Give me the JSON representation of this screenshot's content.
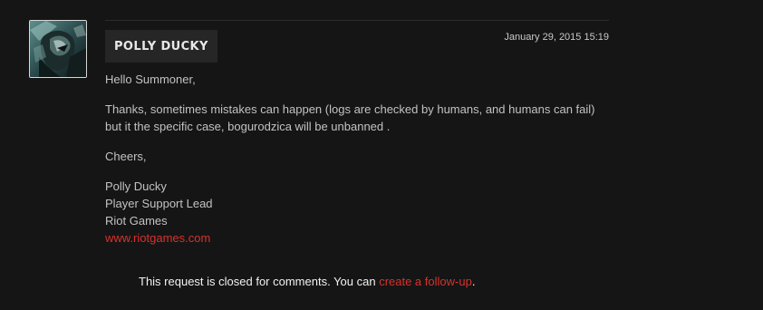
{
  "post": {
    "author": "POLLY DUCKY",
    "timestamp": "January 29, 2015 15:19",
    "greeting": "Hello Summoner,",
    "paragraph": "Thanks, sometimes mistakes can happen (logs are checked by humans, and humans can fail) but it the specific case, bogurodzica will be unbanned .",
    "closing": "Cheers,",
    "signature": {
      "name": "Polly Ducky",
      "role": "Player Support Lead",
      "company": "Riot Games",
      "website": "www.riotgames.com"
    }
  },
  "footer": {
    "closed_prefix": "This request is closed for comments. You can ",
    "follow_up_link": "create a follow-up",
    "closed_suffix": "."
  },
  "colors": {
    "background": "#151515",
    "link": "#d7322d",
    "text": "#c2c2c2"
  },
  "icons": {
    "avatar": "champion-portrait"
  }
}
